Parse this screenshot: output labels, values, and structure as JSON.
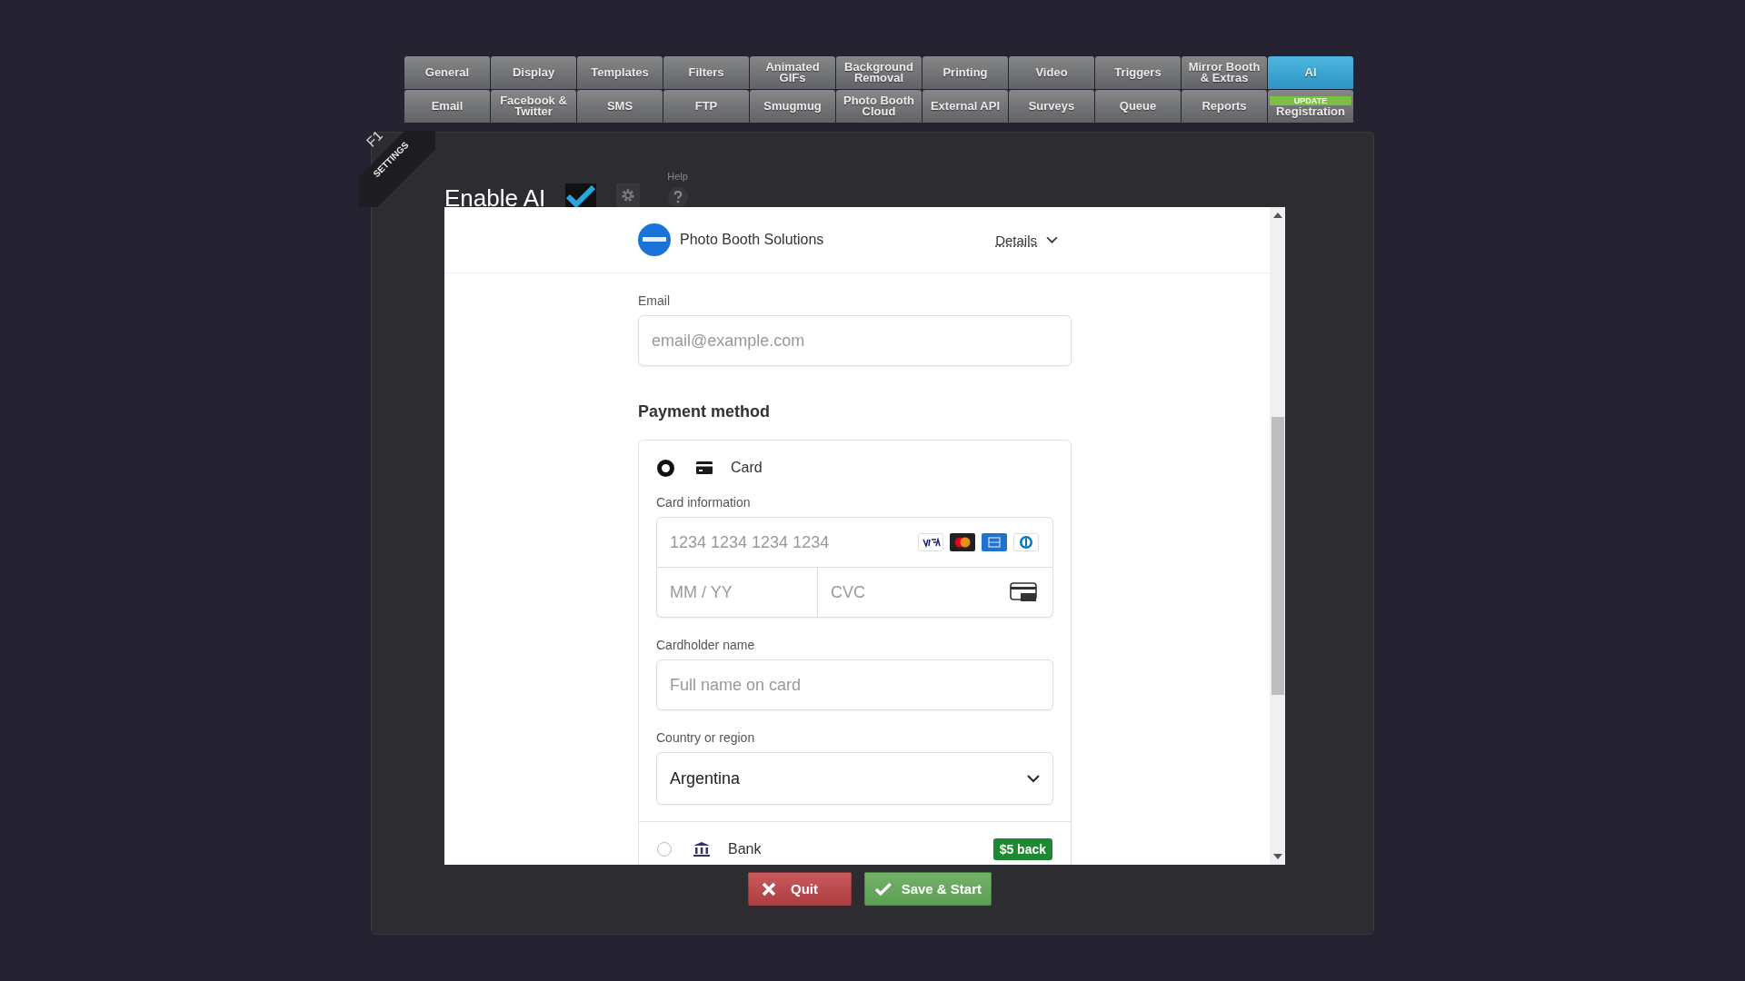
{
  "tab_rows": [
    [
      {
        "label": "General",
        "selected": false
      },
      {
        "label": "Display",
        "selected": false
      },
      {
        "label": "Templates",
        "selected": false
      },
      {
        "label": "Filters",
        "selected": false
      },
      {
        "label": "Animated GIFs",
        "selected": false
      },
      {
        "label": "Background Removal",
        "selected": false
      },
      {
        "label": "Printing",
        "selected": false
      },
      {
        "label": "Video",
        "selected": false
      },
      {
        "label": "Triggers",
        "selected": false
      },
      {
        "label": "Mirror Booth & Extras",
        "selected": false
      },
      {
        "label": "AI",
        "selected": true
      }
    ],
    [
      {
        "label": "Email",
        "selected": false
      },
      {
        "label": "Facebook & Twitter",
        "selected": false
      },
      {
        "label": "SMS",
        "selected": false
      },
      {
        "label": "FTP",
        "selected": false
      },
      {
        "label": "Smugmug",
        "selected": false
      },
      {
        "label": "Photo Booth Cloud",
        "selected": false
      },
      {
        "label": "External API",
        "selected": false
      },
      {
        "label": "Surveys",
        "selected": false
      },
      {
        "label": "Queue",
        "selected": false
      },
      {
        "label": "Reports",
        "selected": false
      },
      {
        "label": "Registration",
        "selected": false,
        "badge": "UPDATE"
      }
    ]
  ],
  "ribbon": {
    "key": "F1",
    "label": "SETTINGS"
  },
  "enable_ai": {
    "label": "Enable AI",
    "checked": true
  },
  "help_label": "Help",
  "checkout": {
    "merchant": "Photo Booth Solutions",
    "details_link": "Details",
    "email": {
      "label": "Email",
      "placeholder": "email@example.com"
    },
    "payment_heading": "Payment method",
    "methods": [
      {
        "kind": "card",
        "label": "Card",
        "selected": true
      },
      {
        "kind": "bank",
        "label": "Bank",
        "selected": false,
        "badge": "$5 back"
      }
    ],
    "card_info_label": "Card information",
    "card_number_placeholder": "1234 1234 1234 1234",
    "expiry_placeholder": "MM / YY",
    "cvc_placeholder": "CVC",
    "cardholder": {
      "label": "Cardholder name",
      "placeholder": "Full name on card"
    },
    "country": {
      "label": "Country or region",
      "value": "Argentina"
    }
  },
  "buttons": [
    {
      "kind": "quit",
      "label": "Quit"
    },
    {
      "kind": "save",
      "label": "Save & Start"
    }
  ]
}
